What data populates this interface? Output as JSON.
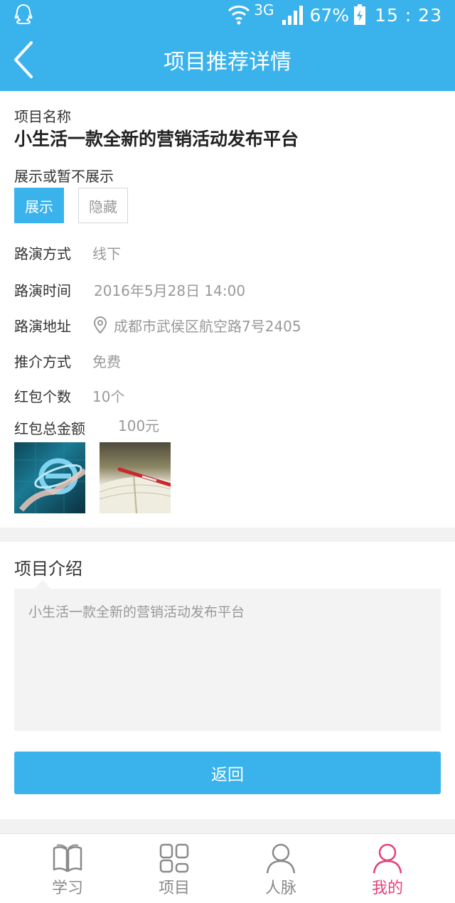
{
  "status_bar": {
    "network": "3G",
    "battery": "67%",
    "time": "15 : 23"
  },
  "header": {
    "title": "项目推荐详情"
  },
  "detail": {
    "name_label": "项目名称",
    "name_value": "小生活一款全新的营销活动发布平台",
    "display_label": "展示或暂不展示",
    "show_button": "展示",
    "hide_button": "隐藏",
    "selected": "展示",
    "fields": [
      {
        "key": "路演方式",
        "value": "线下"
      },
      {
        "key": "路演时间",
        "value": "2016年5月28日 14:00"
      },
      {
        "key": "路演地址",
        "value": "成都市武侯区航空路7号2405"
      },
      {
        "key": "推介方式",
        "value": "免费"
      },
      {
        "key": "红包个数",
        "value": "10个"
      },
      {
        "key": "红包总金额",
        "value": "100元"
      }
    ]
  },
  "intro": {
    "title": "项目介绍",
    "text": "小生活一款全新的营销活动发布平台",
    "return_button": "返回"
  },
  "tabs": [
    {
      "label": "学习",
      "icon": "book-icon"
    },
    {
      "label": "项目",
      "icon": "grid-icon"
    },
    {
      "label": "人脉",
      "icon": "person-icon"
    },
    {
      "label": "我的",
      "icon": "profile-icon",
      "active": true
    }
  ],
  "colors": {
    "primary": "#3ab3ec",
    "active_tab": "#e6407a"
  }
}
